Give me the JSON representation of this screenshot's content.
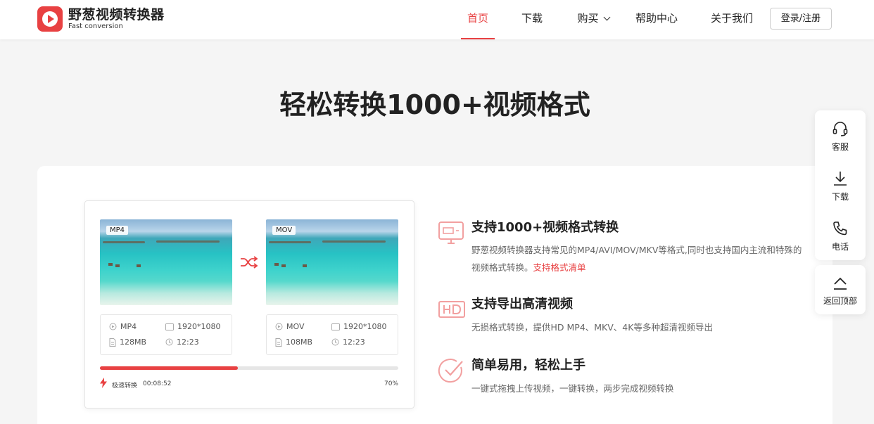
{
  "header": {
    "brand_title": "野葱视频转换器",
    "brand_subtitle": "Fast conversion",
    "nav": {
      "home": "首页",
      "download": "下载",
      "buy": "购买",
      "help": "帮助中心",
      "about": "关于我们"
    },
    "login_label": "登录/注册"
  },
  "headline": "轻松转换1000+视频格式",
  "demo": {
    "source": {
      "tag": "MP4",
      "format": "MP4",
      "resolution": "1920*1080",
      "size": "128MB",
      "duration": "12:23"
    },
    "target": {
      "tag": "MOV",
      "format": "MOV",
      "resolution": "1920*1080",
      "size": "108MB",
      "duration": "12:23"
    },
    "speed_label": "极速转换",
    "elapsed": "00:08:52",
    "progress_percent": 70,
    "progress_text": "70%"
  },
  "features": [
    {
      "icon": "monitor-icon",
      "title": "支持1000+视频格式转换",
      "desc": "野葱视频转换器支持常见的MP4/AVI/MOV/MKV等格式,同时也支持国内主流和特殊的视频格式转换。",
      "link": "支持格式清单"
    },
    {
      "icon": "hd-icon",
      "title": "支持导出高清视频",
      "desc": "无损格式转换，提供HD MP4、MKV、4K等多种超清视频导出"
    },
    {
      "icon": "checkmark-circle-icon",
      "title": "简单易用，轻松上手",
      "desc": "一键式拖拽上传视频，一键转换，两步完成视频转换"
    }
  ],
  "sidebar": {
    "service": "客服",
    "download": "下载",
    "phone": "电话",
    "back_to_top": "返回顶部"
  },
  "colors": {
    "accent": "#e84142",
    "progress_track": "#e6e6e6"
  }
}
